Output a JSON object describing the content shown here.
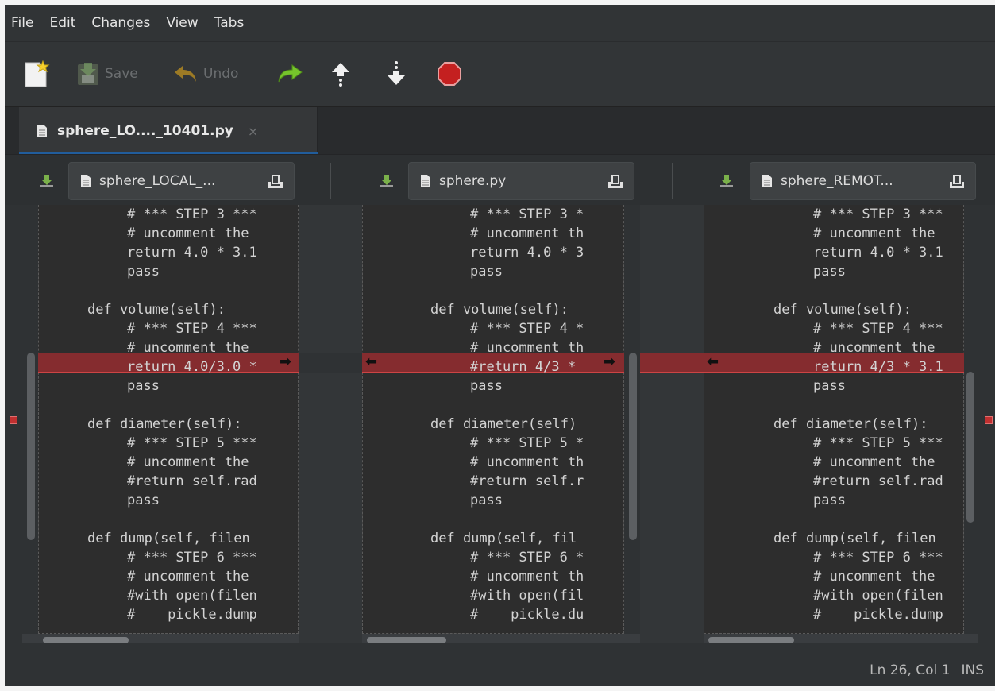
{
  "menu": [
    "File",
    "Edit",
    "Changes",
    "View",
    "Tabs"
  ],
  "toolbar": {
    "new_icon": "new-comparison-icon",
    "save_label": "Save",
    "undo_label": "Undo",
    "redo_icon": "redo-icon",
    "prev_change_icon": "previous-change-icon",
    "next_change_icon": "next-change-icon",
    "stop_icon": "stop-icon"
  },
  "tab": {
    "title": "sphere_LO...._10401.py",
    "close": "×"
  },
  "panes": [
    {
      "file": "sphere_LOCAL_...",
      "lines": [
        "# *** STEP 3 ***",
        "# uncomment the",
        "return 4.0 * 3.1",
        "pass",
        "",
        "def volume(self):",
        "# *** STEP 4 ***",
        "# uncomment the",
        "return 4.0/3.0 *",
        "pass",
        "",
        "def diameter(self):",
        "# *** STEP 5 ***",
        "# uncomment the",
        "#return self.rad",
        "pass",
        "",
        "def dump(self, filen",
        "# *** STEP 6 ***",
        "# uncomment the",
        "#with open(filen",
        "#    pickle.dump"
      ]
    },
    {
      "file": "sphere.py",
      "lines": [
        "# *** STEP 3 *",
        "# uncomment th",
        "return 4.0 * 3",
        "pass",
        "",
        "def volume(self):",
        "# *** STEP 4 *",
        "# uncomment th",
        "#return 4/3 * ",
        "pass",
        "",
        "def diameter(self)",
        "# *** STEP 5 *",
        "# uncomment th",
        "#return self.r",
        "pass",
        "",
        "def dump(self, fil",
        "# *** STEP 6 *",
        "# uncomment th",
        "#with open(fil",
        "#    pickle.du"
      ]
    },
    {
      "file": "sphere_REMOT...",
      "lines": [
        "# *** STEP 3 ***",
        "# uncomment the",
        "return 4.0 * 3.1",
        "pass",
        "",
        "def volume(self):",
        "# *** STEP 4 ***",
        "# uncomment the",
        "return 4/3 * 3.1",
        "pass",
        "",
        "def diameter(self):",
        "# *** STEP 5 ***",
        "# uncomment the",
        "#return self.rad",
        "pass",
        "",
        "def dump(self, filen",
        "# *** STEP 6 ***",
        "# uncomment the",
        "#with open(filen",
        "#    pickle.dump"
      ]
    }
  ],
  "colors": {
    "conflict": "#852c2f",
    "accent": "#215d9c"
  },
  "status": {
    "position": "Ln 26, Col 1",
    "mode": "INS"
  }
}
